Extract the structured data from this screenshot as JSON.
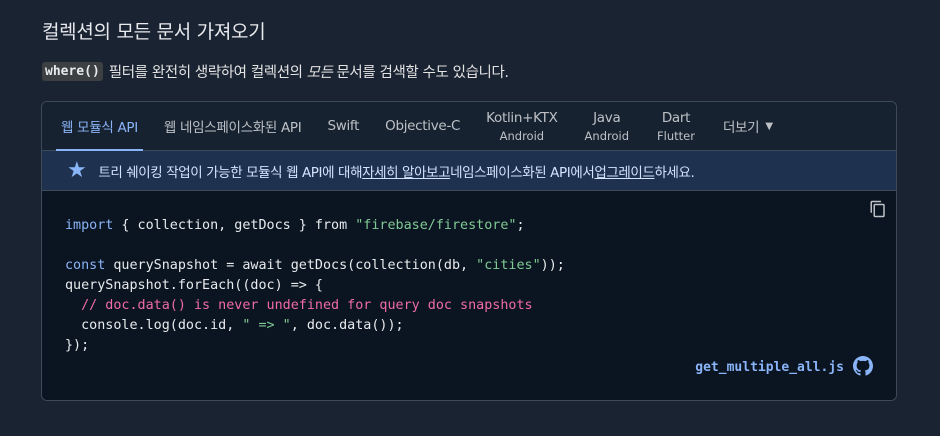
{
  "heading": "컬렉션의 모든 문서 가져오기",
  "para": {
    "code": "where()",
    "before": "필터를 완전히 생략하여 컬렉션의",
    "emph": "모든",
    "after": "문서를 검색할 수도 있습니다."
  },
  "tabs": [
    {
      "label": "웹 모듈식 API",
      "sub": "",
      "active": true
    },
    {
      "label": "웹 네임스페이스화된 API",
      "sub": ""
    },
    {
      "label": "Swift",
      "sub": ""
    },
    {
      "label": "Objective-C",
      "sub": ""
    },
    {
      "label": "Kotlin+KTX",
      "sub": "Android"
    },
    {
      "label": "Java",
      "sub": "Android"
    },
    {
      "label": "Dart",
      "sub": "Flutter"
    },
    {
      "label": "더보기",
      "sub": ""
    }
  ],
  "notice": {
    "icon": "star-icon",
    "t1": "트리 쉐이킹 작업이 가능한 모듈식 웹 API에 대해 ",
    "link1": "자세히 알아보고",
    "t2": " 네임스페이스화된 API에서 ",
    "link2": "업그레이드",
    "t3": "하세요."
  },
  "code": {
    "l1": {
      "kw": "import",
      "a": " { collection, getDocs } ",
      "kw2": "from",
      "sp": " ",
      "str": "\"firebase/firestore\"",
      "end": ";"
    },
    "l3": {
      "kw": "const",
      "a": " querySnapshot = ",
      "kw2": "await",
      "b": " getDocs(collection(db, ",
      "str": "\"cities\"",
      "end": "));"
    },
    "l4": "querySnapshot.forEach((doc) => {",
    "l5": "  // doc.data() is never undefined for query doc snapshots",
    "l6": {
      "a": "  console.log(doc.id, ",
      "str": "\" => \"",
      "end": ", doc.data());"
    },
    "l7": "});"
  },
  "file_link": "get_multiple_all.js",
  "colors": {
    "accent": "#8ab4f8",
    "string": "#81c995",
    "comment": "#f06ba8",
    "background": "#1a2332"
  }
}
